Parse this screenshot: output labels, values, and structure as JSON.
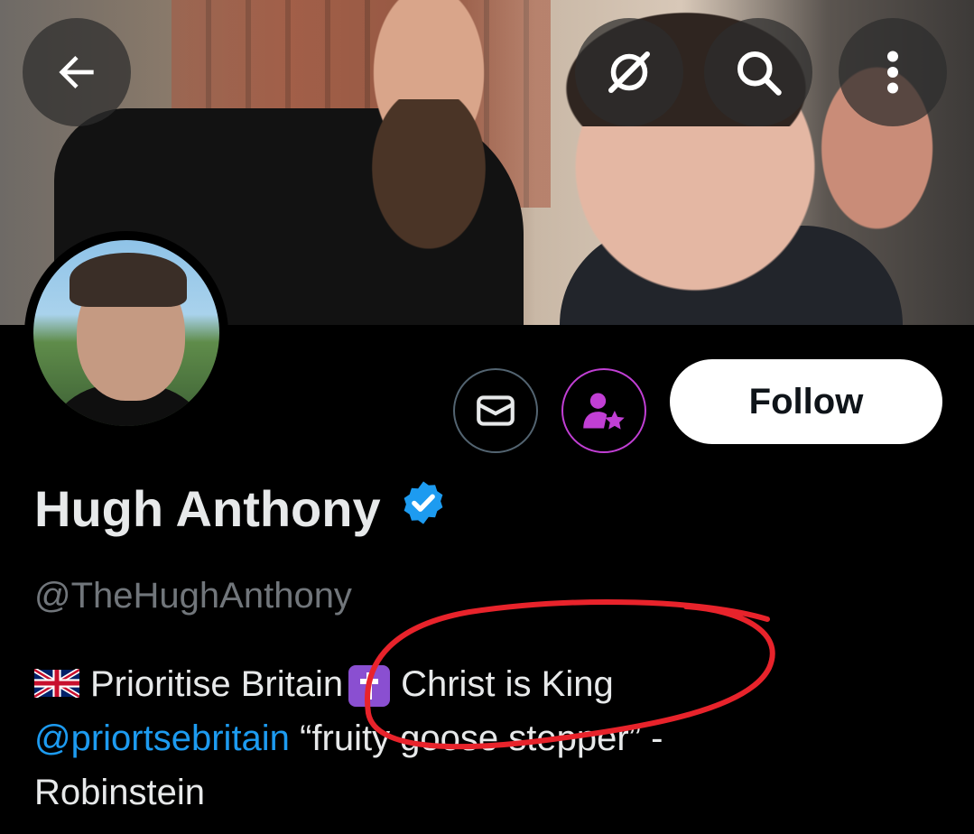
{
  "profile": {
    "display_name": "Hugh Anthony",
    "handle": "@TheHughAnthony",
    "verified": true,
    "follow_label": "Follow",
    "bio": {
      "part1": "Prioritise Britain",
      "part2": "Christ is King",
      "mention": "@priortsebritain",
      "quote": "“fruity goose stepper” -",
      "attribution": "Robinstein"
    }
  },
  "header": {
    "icons": [
      "back-arrow-icon",
      "grok-icon",
      "search-icon",
      "more-vertical-icon"
    ]
  },
  "actions": {
    "icons": [
      "message-icon",
      "subscribe-icon"
    ]
  },
  "colors": {
    "background": "#000000",
    "text_primary": "#e7e9ea",
    "text_secondary": "#71767b",
    "link": "#1d9bf0",
    "verified_badge": "#1d9bf0",
    "subscribe_accent": "#c13fd4",
    "annotation_circle": "#e8232b"
  }
}
